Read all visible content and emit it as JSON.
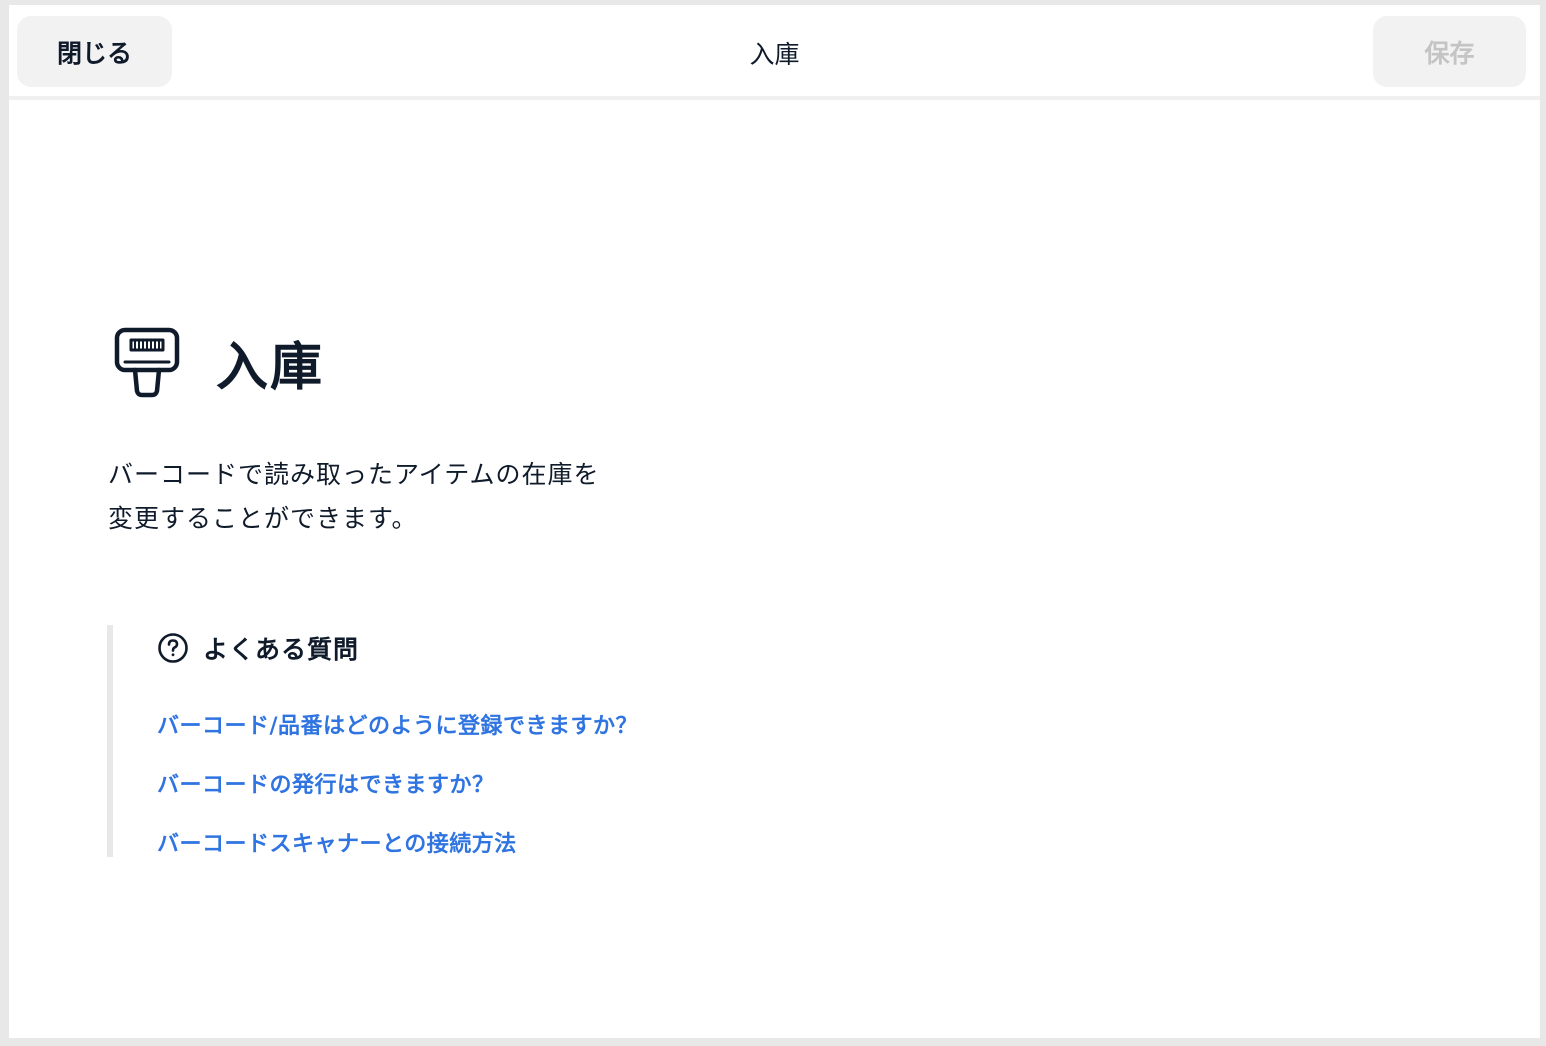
{
  "header": {
    "close_label": "閉じる",
    "title": "入庫",
    "save_label": "保存"
  },
  "hero": {
    "icon": "barcode-scanner-icon",
    "title": "入庫"
  },
  "description": {
    "line1": "バーコードで読み取ったアイテムの在庫を",
    "line2": "変更することができます。"
  },
  "faq": {
    "icon": "question-circle-icon",
    "title": "よくある質問",
    "links": [
      {
        "label": "バーコード/品番はどのように登録できますか？"
      },
      {
        "label": "バーコードの発行はできますか？"
      },
      {
        "label": "バーコードスキャナーとの接続方法"
      }
    ]
  },
  "colors": {
    "text": "#0f1a2a",
    "link": "#2f74e0",
    "button_bg": "#f2f2f2",
    "disabled_text": "#c4c4c4"
  }
}
